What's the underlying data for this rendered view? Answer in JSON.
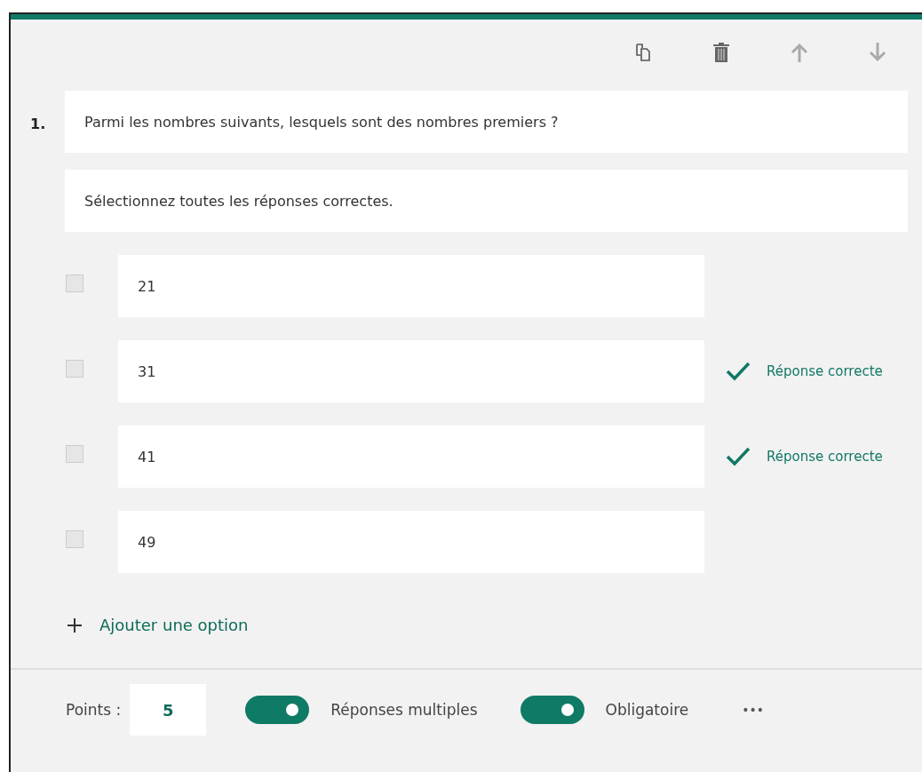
{
  "question": {
    "number": "1.",
    "title": "Parmi les nombres suivants, lesquels sont des nombres premiers ?",
    "subtitle": "Sélectionnez toutes les réponses correctes."
  },
  "options": [
    {
      "text": "21",
      "checked": false,
      "correct": false
    },
    {
      "text": "31",
      "checked": false,
      "correct": true,
      "correct_label": "Réponse correcte"
    },
    {
      "text": "41",
      "checked": false,
      "correct": true,
      "correct_label": "Réponse correcte"
    },
    {
      "text": "49",
      "checked": false,
      "correct": false
    }
  ],
  "add_option": "Ajouter une option",
  "footer": {
    "points_label": "Points :",
    "points_value": "5",
    "toggles": [
      {
        "label": "Réponses multiples",
        "on": true
      },
      {
        "label": "Obligatoire",
        "on": true
      }
    ],
    "more": "•••"
  }
}
